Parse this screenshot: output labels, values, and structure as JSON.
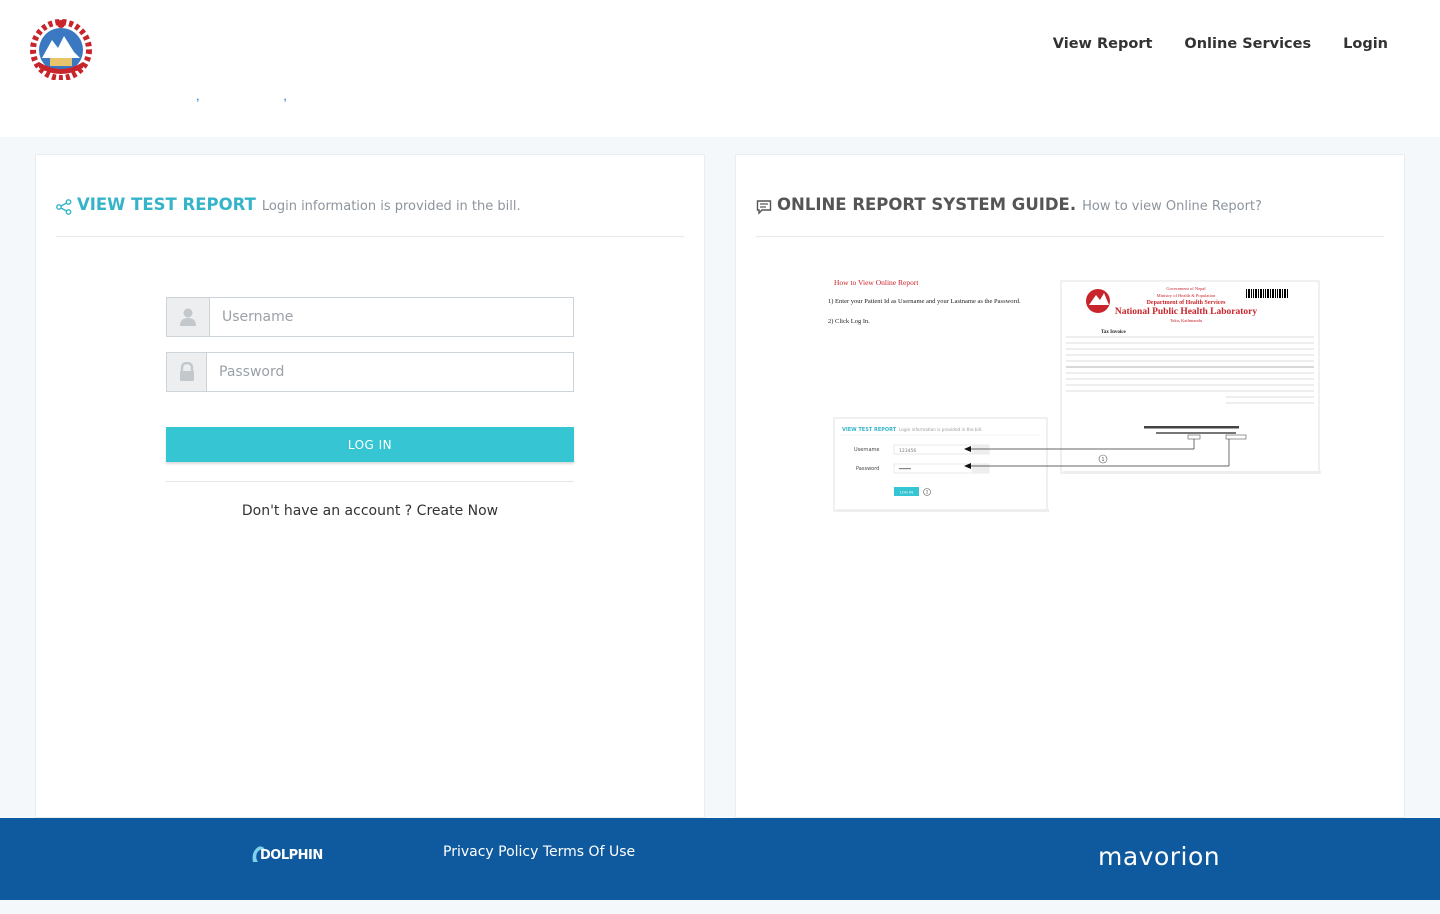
{
  "nav": {
    "items": [
      "View Report",
      "Online Services",
      "Login"
    ]
  },
  "breadcrumb": {
    "text": ", ,"
  },
  "left_panel": {
    "title": "VIEW TEST REPORT",
    "subtitle": "Login information is provided in the bill.",
    "username_placeholder": "Username",
    "password_placeholder": "Password",
    "login_button": "LOG IN",
    "signup_prefix": "Don't have an account ?",
    "signup_link": "Create Now"
  },
  "right_panel": {
    "title": "ONLINE REPORT SYSTEM GUIDE.",
    "subtitle": "How to view Online Report?",
    "guide": {
      "heading": "How to View Online Report",
      "step1": "1) Enter your Patient Id as Username and your Lastname as the Password.",
      "step2": "2) Click Log In.",
      "bill_title": "National Public Health Laboratory",
      "bill_dept": "Department of Health Services",
      "bill_ministry": "Ministry of Health & Population",
      "bill_gov": "Government of Nepal",
      "bill_place": "Teku, Kathmandu",
      "bill_type": "Tax Invoice",
      "mini_title": "VIEW TEST REPORT",
      "mini_sub": "Login information is provided in the bill.",
      "mini_user_label": "Username",
      "mini_pass_label": "Password",
      "mini_user_value": "123456",
      "mini_btn": "LOG IN",
      "marker1": "1",
      "marker2": "2"
    }
  },
  "footer": {
    "dolphin": "DOLPHIN",
    "privacy": "Privacy Policy",
    "terms": "Terms Of Use",
    "brand": "mavorion"
  },
  "colors": {
    "accent": "#35c5d3",
    "title_teal": "#35b4c9",
    "footer_bg": "#0f5a9e"
  }
}
